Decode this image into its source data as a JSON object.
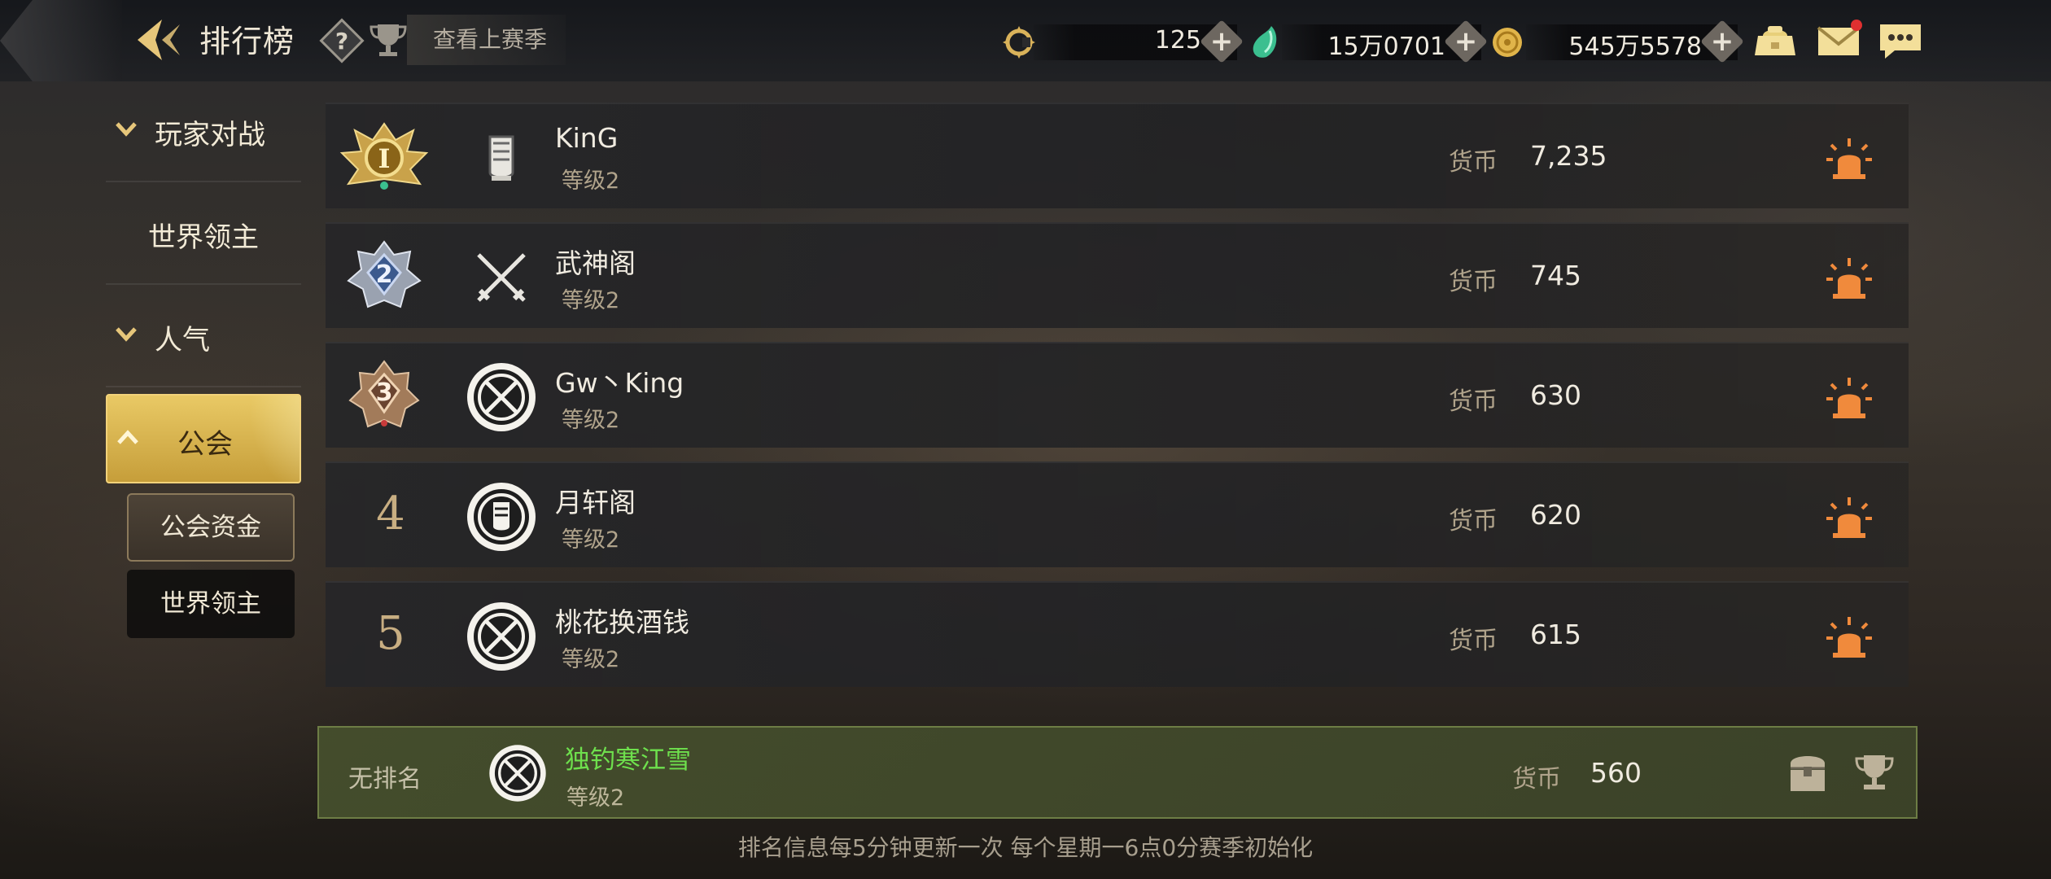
{
  "header": {
    "title": "排行榜",
    "season_button": "查看上赛季"
  },
  "currencies": [
    {
      "name": "season-coin",
      "value": "125"
    },
    {
      "name": "jade",
      "value": "15万0701"
    },
    {
      "name": "gold",
      "value": "545万5578"
    }
  ],
  "sidebar": {
    "items": [
      {
        "label": "玩家对战",
        "expandable": true
      },
      {
        "label": "世界领主",
        "expandable": false
      },
      {
        "label": "人气",
        "expandable": true
      },
      {
        "label": "公会",
        "expandable": true,
        "active": true
      }
    ],
    "sub_items": [
      {
        "label": "公会资金",
        "selected": true
      },
      {
        "label": "世界领主",
        "selected": false
      }
    ]
  },
  "rankings": [
    {
      "rank": "1",
      "name": "KinG",
      "level": "等级2",
      "currency_label": "货币",
      "value": "7,235"
    },
    {
      "rank": "2",
      "name": "武神阁",
      "level": "等级2",
      "currency_label": "货币",
      "value": "745"
    },
    {
      "rank": "3",
      "name": "Gw丶King",
      "level": "等级2",
      "currency_label": "货币",
      "value": "630"
    },
    {
      "rank": "4",
      "name": "月轩阁",
      "level": "等级2",
      "currency_label": "货币",
      "value": "620"
    },
    {
      "rank": "5",
      "name": "桃花换酒钱",
      "level": "等级2",
      "currency_label": "货币",
      "value": "615"
    }
  ],
  "my_guild": {
    "rank_text": "无排名",
    "name": "独钓寒江雪",
    "level": "等级2",
    "currency_label": "货币",
    "value": "560"
  },
  "footer": "排名信息每5分钟更新一次 每个星期一6点0分赛季初始化",
  "colors": {
    "accent_gold": "#e9c965",
    "my_name_green": "#6ee04d",
    "like_orange": "#f08a3c"
  }
}
